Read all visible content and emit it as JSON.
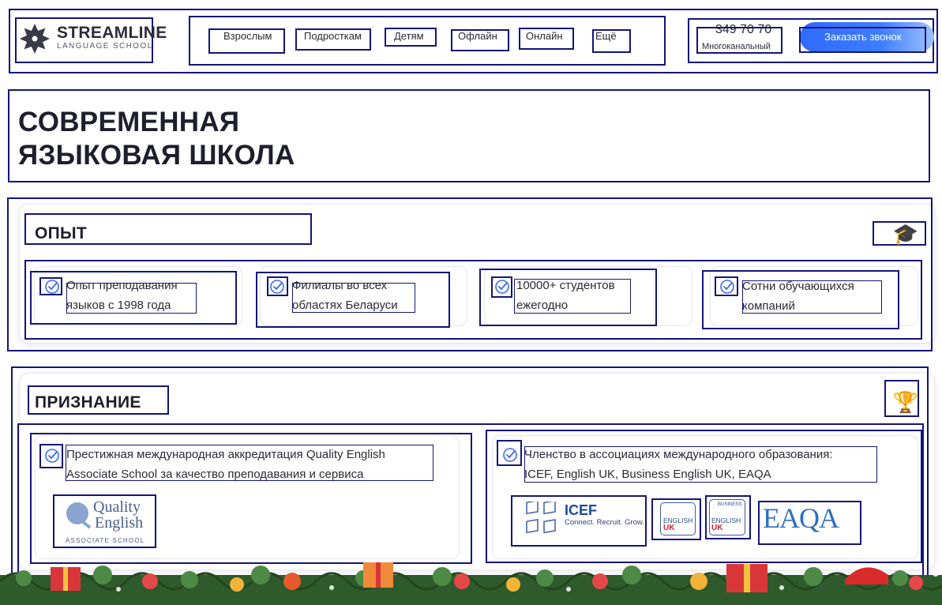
{
  "header": {
    "logo": {
      "name": "STREAMLINE",
      "tagline": "LANGUAGE SCHOOL"
    },
    "nav": [
      "Взрослым",
      "Подросткам",
      "Детям",
      "Офлайн",
      "Онлайн",
      "Ещё"
    ],
    "phone": "349 70 70",
    "phone_label": "Многоканальный",
    "cta_label": "Заказать звонок"
  },
  "hero": {
    "title_line1": "СОВРЕМЕННАЯ",
    "title_line2": "ЯЗЫКОВАЯ ШКОЛА"
  },
  "experience": {
    "title": "ОПЫТ",
    "icon": "graduation-cap-icon",
    "facts": [
      {
        "line1": "Опыт преподавания",
        "line2": "языков с 1998 года"
      },
      {
        "line1": "Филиалы во всех",
        "line2": "областях Беларуси"
      },
      {
        "line1": "10000+ студентов",
        "line2": "ежегодно"
      },
      {
        "line1": "Сотни обучающихся",
        "line2": "компаний"
      }
    ]
  },
  "recognition": {
    "title": "ПРИЗНАНИЕ",
    "icon": "trophy-icon",
    "items": [
      {
        "line1": "Престижная международная аккредитация Quality English",
        "line2": "Associate School за качество преподавания и сервиса",
        "logos": [
          {
            "l1": "Quality",
            "l2": "English",
            "l3": "ASSOCIATE SCHOOL"
          }
        ]
      },
      {
        "line1": "Членство в ассоциациях международного образования:",
        "line2": "ICEF, English UK, Business English UK, EAQA",
        "logos": [
          {
            "name": "ICEF",
            "tagline": "Connect. Recruit. Grow."
          },
          {
            "l1": "ENGLISH",
            "l2": "UK"
          },
          {
            "l0": "BUSINESS",
            "l1": "ENGLISH",
            "l2": "UK"
          },
          {
            "name": "EAQA"
          }
        ]
      }
    ]
  },
  "colors": {
    "accent_blue": "#2f6bff",
    "outline_navy": "#14147a",
    "text_dark": "#1e1e2c",
    "uk_red": "#d8202a"
  }
}
